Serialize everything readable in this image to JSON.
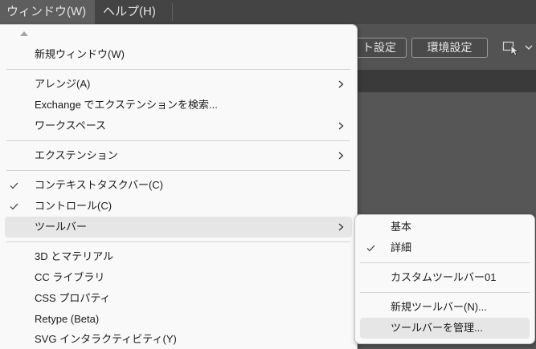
{
  "colors": {
    "menubar_bg": "#444444",
    "menubar_active_bg": "#5e5e5e",
    "app_bg": "#535353",
    "tabstrip_bg": "#3a3a3a",
    "canvas_bg": "#565656",
    "menu_bg": "#f9f9f9",
    "menu_highlight_bg": "#e6e6e6"
  },
  "menubar": {
    "window": {
      "label": "ウィンドウ(W)",
      "active": true
    },
    "help": {
      "label": "ヘルプ(H)",
      "active": false
    }
  },
  "controlbar": {
    "document_setup_button": {
      "label": "ト設定"
    },
    "preferences_button": {
      "label": "環境設定"
    },
    "arrange_icon": "arrange-documents-icon",
    "dropdown_icon": "chevron-down-icon"
  },
  "window_menu": {
    "scroll_up_icon": "triangle-up-icon",
    "check_icon": "check-icon",
    "submenu_icon": "chevron-right-icon",
    "groups": [
      {
        "items": [
          {
            "label": "新規ウィンドウ(W)",
            "checked": false,
            "submenu": false
          }
        ]
      },
      {
        "items": [
          {
            "label": "アレンジ(A)",
            "checked": false,
            "submenu": true
          },
          {
            "label": "Exchange でエクステンションを検索...",
            "checked": false,
            "submenu": false
          },
          {
            "label": "ワークスペース",
            "checked": false,
            "submenu": true
          }
        ]
      },
      {
        "items": [
          {
            "label": "エクステンション",
            "checked": false,
            "submenu": true
          }
        ]
      },
      {
        "items": [
          {
            "label": "コンテキストタスクバー(C)",
            "checked": true,
            "submenu": false
          },
          {
            "label": "コントロール(C)",
            "checked": true,
            "submenu": false
          },
          {
            "label": "ツールバー",
            "checked": false,
            "submenu": true,
            "highlighted": true
          }
        ]
      },
      {
        "items": [
          {
            "label": "3D とマテリアル",
            "checked": false,
            "submenu": false
          },
          {
            "label": "CC ライブラリ",
            "checked": false,
            "submenu": false
          },
          {
            "label": "CSS プロパティ",
            "checked": false,
            "submenu": false
          },
          {
            "label": "Retype (Beta)",
            "checked": false,
            "submenu": false
          },
          {
            "label": "SVG インタラクティビティ(Y)",
            "checked": false,
            "submenu": false
          }
        ]
      }
    ]
  },
  "toolbar_submenu": {
    "groups": [
      {
        "items": [
          {
            "label": "基本",
            "checked": false
          },
          {
            "label": "詳細",
            "checked": true
          }
        ]
      },
      {
        "items": [
          {
            "label": "カスタムツールバー01",
            "checked": false
          }
        ]
      },
      {
        "items": [
          {
            "label": "新規ツールバー(N)...",
            "checked": false
          },
          {
            "label": "ツールバーを管理...",
            "checked": false,
            "highlighted": true
          }
        ]
      }
    ]
  }
}
